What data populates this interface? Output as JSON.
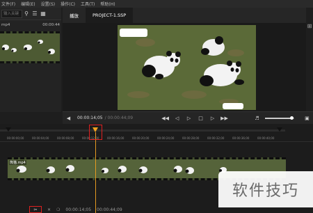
{
  "menubar": {
    "items": [
      "文件(F)",
      "编辑(E)",
      "设置(S)",
      "操作(C)",
      "工具(T)",
      "帮助(H)"
    ]
  },
  "left_panel": {
    "search_placeholder": "输入关键",
    "asset_name": "mp4",
    "asset_duration": "00:00:44"
  },
  "preview": {
    "tabs": [
      "播放",
      "PROJECT-1.SSP"
    ],
    "current_time": "00:00:14;05",
    "total_time": "/ 00:00:44;09"
  },
  "timeline": {
    "tick_labels": [
      "00:00:00;00",
      "00:00:04;00",
      "00:00:08;00",
      "00:00:12;00",
      "00:00:16;00",
      "00:00:20;00",
      "00:00:24;00",
      "00:00:28;00",
      "00:00:32;00",
      "00:00:36;00",
      "00:00:40;00"
    ],
    "clip_name": "熊猫.mp4",
    "bottom_time_1": "00:00:14;05",
    "bottom_time_2": "00:00:44;09"
  },
  "watermark": {
    "text": "软件技巧"
  },
  "colors": {
    "accent": "#f0a020",
    "highlight": "#e02020",
    "bg": "#1e1e1e"
  }
}
